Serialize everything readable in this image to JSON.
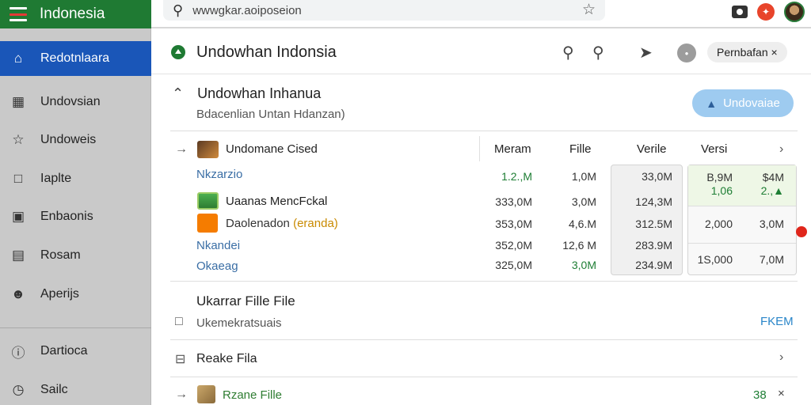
{
  "brand": {
    "title": "Indonesia"
  },
  "search": {
    "placeholder": "wwwgkar.aoiposeion"
  },
  "sidebar": {
    "items": [
      {
        "label": "Redotnlaara",
        "icon": "home-icon"
      },
      {
        "label": "Undovsian",
        "icon": "chart-icon"
      },
      {
        "label": "Undoweis",
        "icon": "star-icon"
      },
      {
        "label": "Iaplte",
        "icon": "chat-icon"
      },
      {
        "label": "Enbaonis",
        "icon": "bag-icon"
      },
      {
        "label": "Rosam",
        "icon": "document-icon"
      },
      {
        "label": "Aperijs",
        "icon": "user-icon"
      },
      {
        "label": "Dartioca",
        "icon": "info-icon"
      },
      {
        "label": "Sailc",
        "icon": "clock-icon"
      }
    ]
  },
  "header": {
    "title": "Undowhan Indonsia",
    "chip_label": "Pernbafan ×",
    "circle_label": "•"
  },
  "section": {
    "title": "Undowhan Inhanua",
    "subtitle": "Bdacenlian Untan Hdanzan)",
    "button_label": "Undovaiae"
  },
  "table": {
    "headers": [
      "Undomane Cised",
      "Meram",
      "Fille",
      "Verile",
      "Versi"
    ],
    "rows": [
      {
        "label": "Nkzarzio",
        "meram": "1.2.,M",
        "file": "1,0M",
        "verile": "33,0M",
        "v1": "B,9M",
        "v2": "$4M"
      },
      {
        "label": "Uaanas MencFckal",
        "meram": "333,0M",
        "file": "3,0M",
        "verile": "124,3M",
        "v1": "1,06",
        "v2": "2.,▲"
      },
      {
        "label": "Daolenadon",
        "label_extra": "(eranda)",
        "meram": "353,0M",
        "file": "4,6.M",
        "verile": "312.5M",
        "v1": "2,000",
        "v2": "3,0M"
      },
      {
        "label": "Nkandei",
        "meram": "352,0M",
        "file": "12,6 M",
        "verile": "283.9M"
      },
      {
        "label": "Okaeag",
        "meram": "325,0M",
        "file": "3,0M",
        "verile": "234.9M",
        "v1": "1S,000",
        "v2": "7,0M"
      }
    ]
  },
  "files": {
    "title": "Ukarrar Fille File",
    "subtitle": "Ukemekratsuais",
    "subtitle_action": "FKEM",
    "row1": "Reake Fila",
    "row2": "Rzane Fille",
    "row2_count": "38",
    "row2_close": "×"
  },
  "colors": {
    "brand_green": "#1f7a33",
    "active_blue": "#1a56b8",
    "sidebar_gray": "#c9c9c9",
    "accent_pill": "#9ecbf0",
    "alert_red": "#e0261b"
  }
}
